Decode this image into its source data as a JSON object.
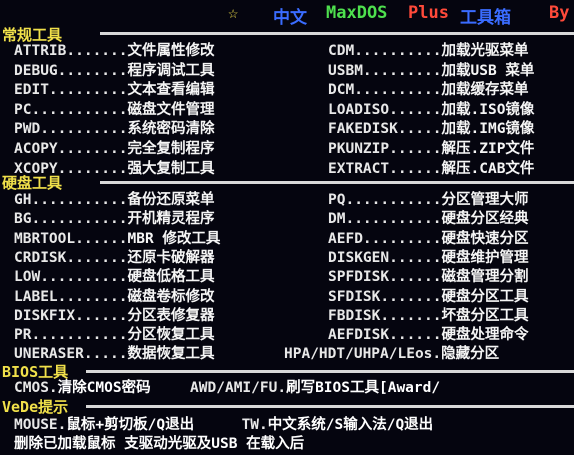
{
  "title": {
    "star": "☆",
    "zh": "中文",
    "app": "MaxDOS",
    "plus": "Plus",
    "toolbox": "工具箱",
    "by": "By"
  },
  "colors": {
    "background": "#05050f",
    "section": "#f0e04a",
    "star": "#f0e04a",
    "title_blue": "#3a6cff",
    "title_green": "#4ee04e",
    "title_red": "#ff4a3a"
  },
  "sections": {
    "common": "常规工具",
    "disk": "硬盘工具",
    "bios": "BIOS工具",
    "vede": "VeDe提示"
  },
  "common_left": [
    {
      "cmd": "ATTRIB.......",
      "desc": "文件属性修改"
    },
    {
      "cmd": "DEBUG........",
      "desc": "程序调试工具"
    },
    {
      "cmd": "EDIT.........",
      "desc": "文本查看编辑"
    },
    {
      "cmd": "PC...........",
      "desc": "磁盘文件管理"
    },
    {
      "cmd": "PWD..........",
      "desc": "系统密码清除"
    },
    {
      "cmd": "ACOPY........",
      "desc": "完全复制程序"
    },
    {
      "cmd": "XCOPY........",
      "desc": "强大复制工具"
    }
  ],
  "common_right": [
    {
      "cmd": "CDM..........",
      "desc": "加载光驱菜单"
    },
    {
      "cmd": "USBM.........",
      "desc": "加载USB 菜单"
    },
    {
      "cmd": "DCM..........",
      "desc": "加载缓存菜单"
    },
    {
      "cmd": "LOADISO......",
      "desc": "加载.ISO镜像"
    },
    {
      "cmd": "FAKEDISK.....",
      "desc": "加载.IMG镜像"
    },
    {
      "cmd": "PKUNZIP......",
      "desc": "解压.ZIP文件"
    },
    {
      "cmd": "EXTRACT......",
      "desc": "解压.CAB文件"
    }
  ],
  "disk_left": [
    {
      "cmd": "GH...........",
      "desc": "备份还原菜单"
    },
    {
      "cmd": "BG...........",
      "desc": "开机精灵程序"
    },
    {
      "cmd": "MBRTOOL......",
      "desc": "MBR 修改工具"
    },
    {
      "cmd": "CRDISK.......",
      "desc": "还原卡破解器"
    },
    {
      "cmd": "LOW..........",
      "desc": "硬盘低格工具"
    },
    {
      "cmd": "LABEL........",
      "desc": "磁盘卷标修改"
    },
    {
      "cmd": "DISKFIX......",
      "desc": "分区表修复器"
    },
    {
      "cmd": "PR...........",
      "desc": "分区恢复工具"
    },
    {
      "cmd": "UNERASER.....",
      "desc": "数据恢复工具"
    }
  ],
  "disk_right": [
    {
      "cmd": "PQ...........",
      "desc": "分区管理大师"
    },
    {
      "cmd": "DM...........",
      "desc": "硬盘分区经典"
    },
    {
      "cmd": "AEFD.........",
      "desc": "硬盘快速分区"
    },
    {
      "cmd": "DISKGEN......",
      "desc": "硬盘维护管理"
    },
    {
      "cmd": "SPFDISK......",
      "desc": "磁盘管理分割"
    },
    {
      "cmd": "SFDISK.......",
      "desc": "硬盘分区工具"
    },
    {
      "cmd": "FBDISK.......",
      "desc": "坏盘分区工具"
    },
    {
      "cmd": "AEFDISK......",
      "desc": "硬盘处理命令"
    }
  ],
  "disk_hpa": {
    "cmd": "HPA/HDT/UHPA/LEos.",
    "desc": "隐藏分区"
  },
  "bios_row": {
    "cmos_cmd": "CMOS.",
    "cmos_desc": "清除CMOS密码",
    "awd_cmd": "AWD/AMI/FU.",
    "awd_desc": "刷写BIOS工具[Award/"
  },
  "vede_rows": [
    {
      "a_cmd": "MOUSE.",
      "a_desc": "鼠标+剪切板/Q退出",
      "b_cmd": "TW.",
      "b_desc": "中文系统/S输入法/Q退出"
    },
    {
      "a_cmd": "",
      "a_desc": "删除已加载鼠标  支驱动光驱及USB  在载入后",
      "b_cmd": "",
      "b_desc": ""
    }
  ]
}
